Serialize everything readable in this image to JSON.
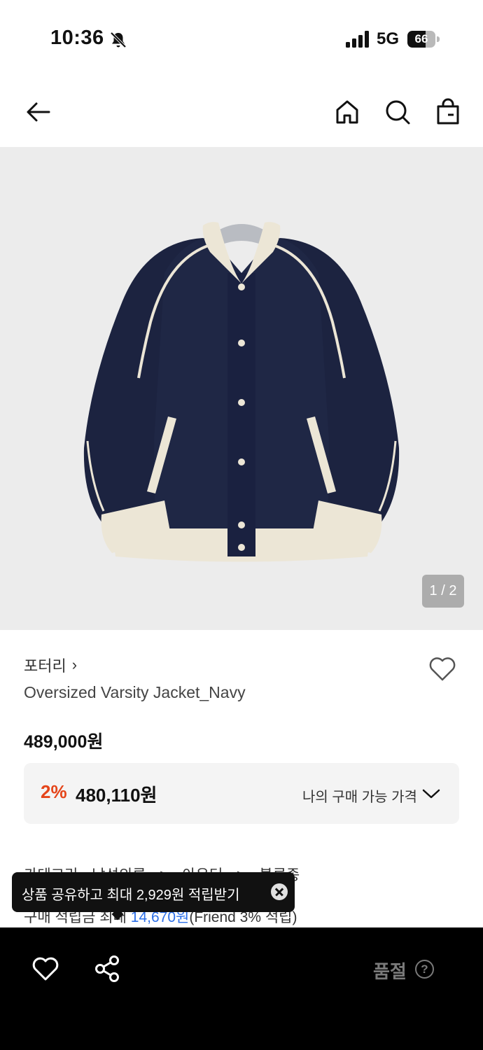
{
  "status_bar": {
    "time": "10:36",
    "network": "5G",
    "battery": "66",
    "battery_level": 0.66,
    "icons": [
      "bell-slash-icon",
      "signal-icon",
      "battery-icon"
    ]
  },
  "nav": {
    "icons": [
      "back-arrow-icon",
      "home-icon",
      "search-icon",
      "shopping-bag-icon"
    ]
  },
  "gallery": {
    "indicator": "1 / 2",
    "image_description_icon": "jacket-image"
  },
  "product": {
    "brand": "포터리",
    "brand_chevron": "›",
    "name": "Oversized Varsity Jacket_Navy",
    "price": "489,000원",
    "discount_rate": "2%",
    "discount_price": "480,110원",
    "price_toggle_label": "나의 구매 가능 가격"
  },
  "category": {
    "label": "카테고리",
    "path": [
      "남성의류",
      "아우터",
      "블루종"
    ],
    "separator": ">"
  },
  "points": {
    "label": "구매 적립금",
    "prefix": "최대",
    "value": "14,670원",
    "suffix": "(Friend 3% 적립)"
  },
  "toast": {
    "text": "상품 공유하고 최대 2,929원 적립받기"
  },
  "bottom_bar": {
    "status": "품절",
    "help": "?"
  },
  "colors": {
    "discount": "#e5451a",
    "link_blue": "#2c6fe8",
    "bottom_bar_bg": "#000000",
    "navy": "#1c2340",
    "cream": "#ece6d6"
  }
}
